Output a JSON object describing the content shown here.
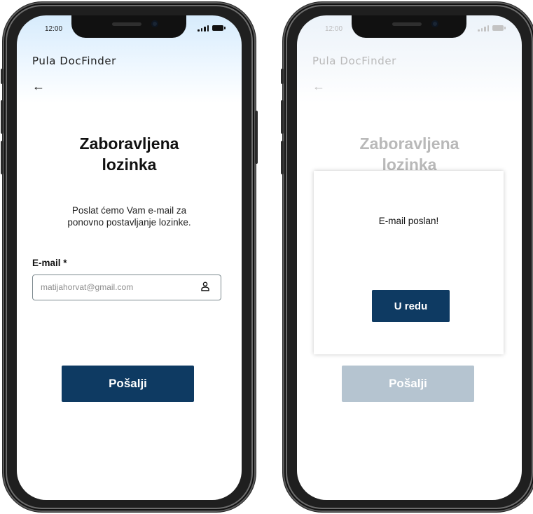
{
  "colors": {
    "primary": "#0e3a62",
    "primary_disabled": "#b5c4d0",
    "screen_gradient_top": "#d6ebfc"
  },
  "phone_left": {
    "status": {
      "time": "12:00",
      "signal_icon": "signal-bars-icon",
      "battery_icon": "battery-icon"
    },
    "brand": "Pula DocFinder",
    "back_icon": "←",
    "title_line1": "Zaboravljena",
    "title_line2": "lozinka",
    "subtitle_line1": "Poslat ćemo Vam e-mail za",
    "subtitle_line2": "ponovno postavljanje lozinke.",
    "email_label": "E-mail *",
    "email_placeholder": "matijahorvat@gmail.com",
    "email_icon": "user-icon",
    "submit_label": "Pošalji"
  },
  "phone_right": {
    "status": {
      "time": "12:00"
    },
    "brand": "Pula DocFinder",
    "back_icon": "←",
    "title_line1": "Zaboravljena",
    "title_line2": "lozinka",
    "modal": {
      "message": "E-mail poslan!",
      "ok_label": "U redu"
    },
    "submit_label": "Pošalji"
  }
}
